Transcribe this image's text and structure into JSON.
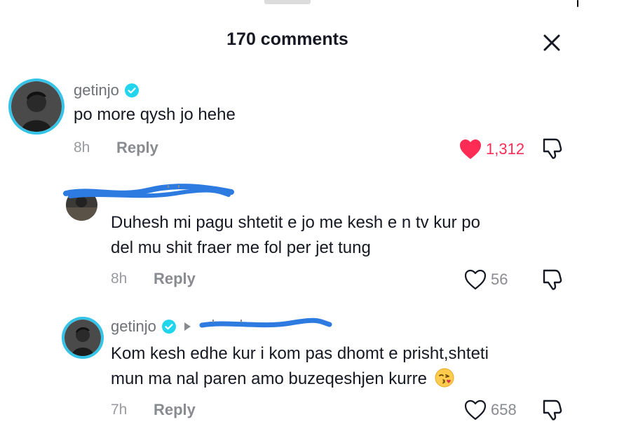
{
  "header": {
    "title": "170 comments"
  },
  "comments": [
    {
      "username": "getinjo",
      "verified": true,
      "text": "po more qysh jo hehe",
      "time": "8h",
      "reply_label": "Reply",
      "likes": "1,312",
      "liked": true
    },
    {
      "username": "",
      "verified": false,
      "text_line1": "Duhesh mi pagu shtetit e jo me kesh e n tv kur po",
      "text_line2": "del mu shit fraer me fol per jet tung",
      "time": "8h",
      "reply_label": "Reply",
      "likes": "56",
      "liked": false
    },
    {
      "username": "getinjo",
      "verified": true,
      "text_line1": "Kom kesh edhe kur i kom pas dhomt e prisht,shteti",
      "text_line2": "mun ma nal paren amo buzeqeshjen kurre",
      "time": "7h",
      "reply_label": "Reply",
      "likes": "658",
      "liked": false
    }
  ],
  "colors": {
    "accent_like": "#fe2c55",
    "ring": "#35c3e8",
    "verified": "#20d5ec",
    "scribble": "#2d7be0"
  }
}
